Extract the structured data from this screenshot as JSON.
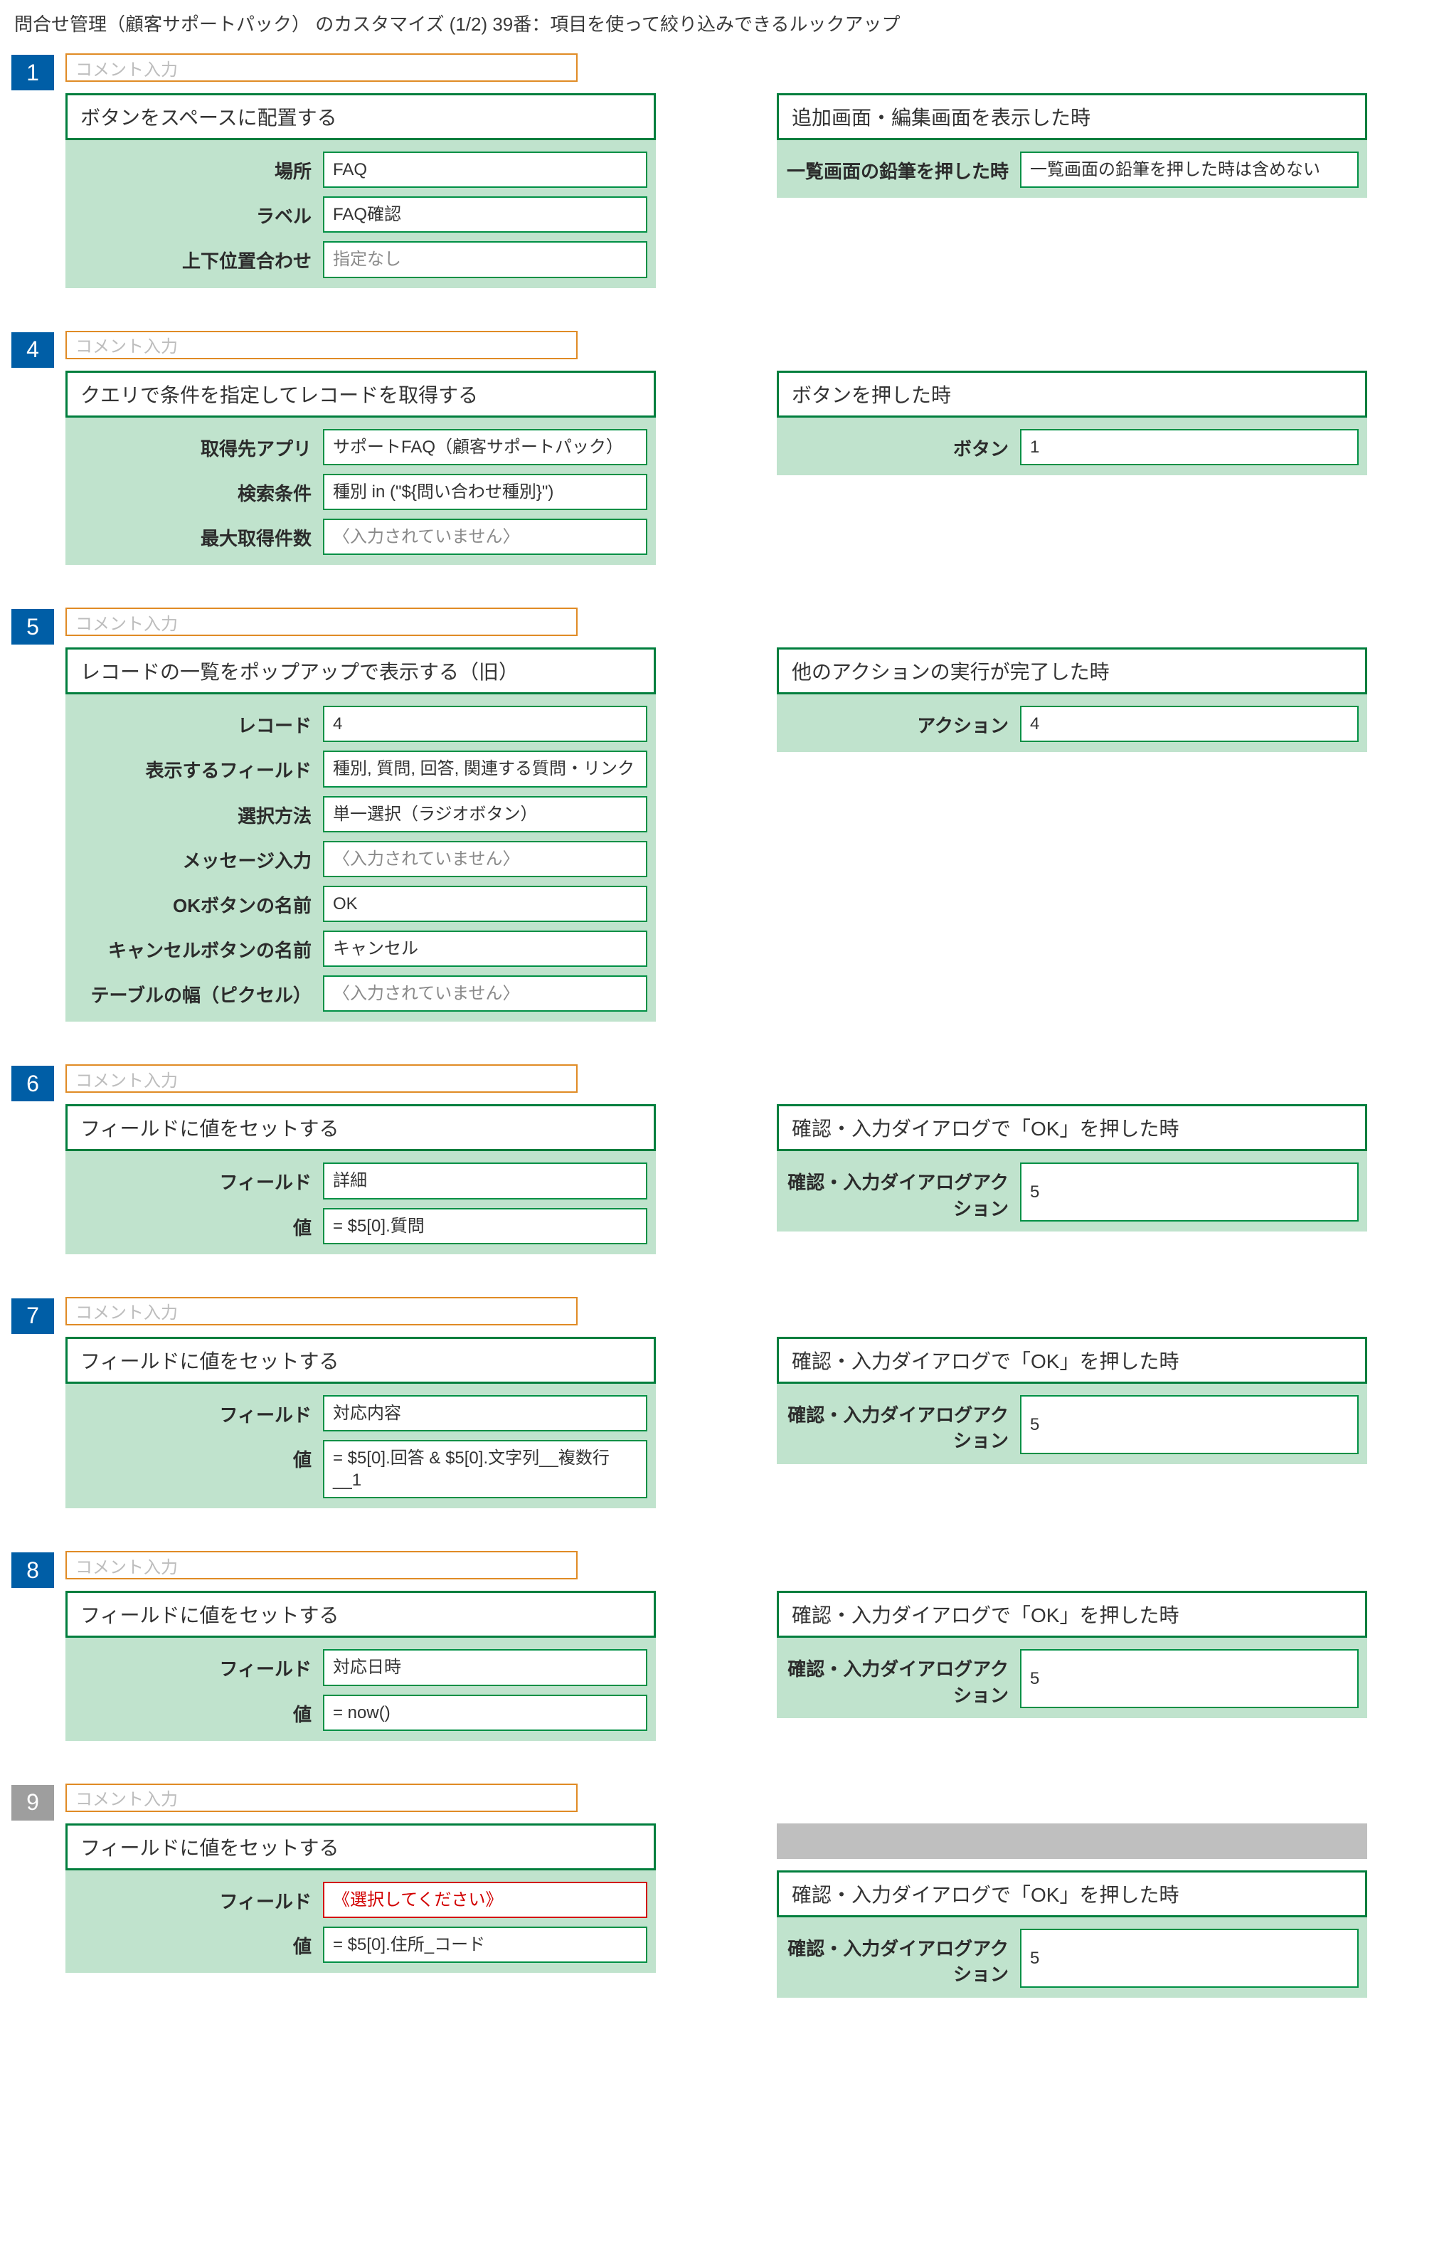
{
  "title": "問合せ管理（顧客サポートパック） のカスタマイズ (1/2) 39番：項目を使って絞り込みできるルックアップ",
  "common": {
    "comment_placeholder": "コメント入力",
    "empty": "〈入力されていません〉"
  },
  "steps": [
    {
      "id": "1",
      "badge_variant": "blue",
      "action": {
        "title": "ボタンをスペースに配置する",
        "rows": [
          {
            "label": "場所",
            "value": "FAQ"
          },
          {
            "label": "ラベル",
            "value": "FAQ確認"
          },
          {
            "label": "上下位置合わせ",
            "value": "指定なし",
            "muted": true
          }
        ]
      },
      "cond": {
        "title": "追加画面・編集画面を表示した時",
        "rows": [
          {
            "label": "一覧画面の鉛筆を押した時",
            "value": "一覧画面の鉛筆を押した時は含めない"
          }
        ]
      }
    },
    {
      "id": "4",
      "badge_variant": "blue",
      "action": {
        "title": "クエリで条件を指定してレコードを取得する",
        "rows": [
          {
            "label": "取得先アプリ",
            "value": "サポートFAQ（顧客サポートパック）"
          },
          {
            "label": "検索条件",
            "value": "種別 in (\"${問い合わせ種別}\")"
          },
          {
            "label": "最大取得件数",
            "value": "〈入力されていません〉",
            "muted": true
          }
        ]
      },
      "cond": {
        "title": "ボタンを押した時",
        "rows": [
          {
            "label": "ボタン",
            "value": "1"
          }
        ]
      }
    },
    {
      "id": "5",
      "badge_variant": "blue",
      "action": {
        "title": "レコードの一覧をポップアップで表示する（旧）",
        "rows": [
          {
            "label": "レコード",
            "value": "4"
          },
          {
            "label": "表示するフィールド",
            "value": "種別, 質問, 回答, 関連する質問・リンク"
          },
          {
            "label": "選択方法",
            "value": "単一選択（ラジオボタン）"
          },
          {
            "label": "メッセージ入力",
            "value": "〈入力されていません〉",
            "muted": true
          },
          {
            "label": "OKボタンの名前",
            "value": "OK"
          },
          {
            "label": "キャンセルボタンの名前",
            "value": "キャンセル"
          },
          {
            "label": "テーブルの幅（ピクセル）",
            "value": "〈入力されていません〉",
            "muted": true
          }
        ]
      },
      "cond": {
        "title": "他のアクションの実行が完了した時",
        "rows": [
          {
            "label": "アクション",
            "value": "4"
          }
        ]
      }
    },
    {
      "id": "6",
      "badge_variant": "blue",
      "action": {
        "title": "フィールドに値をセットする",
        "rows": [
          {
            "label": "フィールド",
            "value": "詳細"
          },
          {
            "label": "値",
            "value": "= $5[0].質問"
          }
        ]
      },
      "cond": {
        "title": "確認・入力ダイアログで「OK」を押した時",
        "rows": [
          {
            "label": "確認・入力ダイアログアクション",
            "value": "5"
          }
        ]
      }
    },
    {
      "id": "7",
      "badge_variant": "blue",
      "action": {
        "title": "フィールドに値をセットする",
        "rows": [
          {
            "label": "フィールド",
            "value": "対応内容"
          },
          {
            "label": "値",
            "value": "= $5[0].回答 & $5[0].文字列__複数行__1"
          }
        ]
      },
      "cond": {
        "title": "確認・入力ダイアログで「OK」を押した時",
        "rows": [
          {
            "label": "確認・入力ダイアログアクション",
            "value": "5"
          }
        ]
      }
    },
    {
      "id": "8",
      "badge_variant": "blue",
      "action": {
        "title": "フィールドに値をセットする",
        "rows": [
          {
            "label": "フィールド",
            "value": "対応日時"
          },
          {
            "label": "値",
            "value": "= now()"
          }
        ]
      },
      "cond": {
        "title": "確認・入力ダイアログで「OK」を押した時",
        "rows": [
          {
            "label": "確認・入力ダイアログアクション",
            "value": "5"
          }
        ]
      }
    },
    {
      "id": "9",
      "badge_variant": "gray",
      "side_gray": true,
      "action": {
        "title": "フィールドに値をセットする",
        "rows": [
          {
            "label": "フィールド",
            "value": "《選択してください》",
            "error": true
          },
          {
            "label": "値",
            "value": "= $5[0].住所_コード"
          }
        ]
      },
      "cond": {
        "title": "確認・入力ダイアログで「OK」を押した時",
        "rows": [
          {
            "label": "確認・入力ダイアログアクション",
            "value": "5"
          }
        ]
      }
    }
  ]
}
